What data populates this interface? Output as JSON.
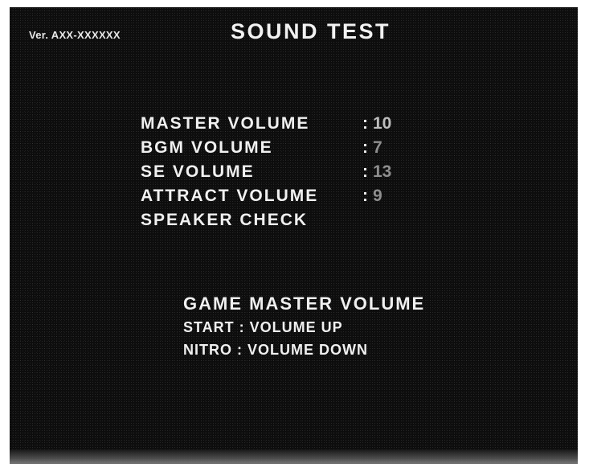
{
  "header": {
    "version": "Ver. AXX-XXXXXX",
    "title": "SOUND TEST"
  },
  "menu": {
    "items": [
      {
        "label": "MASTER VOLUME",
        "separator": ":",
        "value": "10"
      },
      {
        "label": "BGM VOLUME",
        "separator": ":",
        "value": "7"
      },
      {
        "label": "SE VOLUME",
        "separator": ":",
        "value": "13"
      },
      {
        "label": "ATTRACT VOLUME",
        "separator": ":",
        "value": "9"
      },
      {
        "label": "SPEAKER CHECK"
      }
    ]
  },
  "help": {
    "title": "GAME MASTER VOLUME",
    "line1": "START : VOLUME UP",
    "line2": "NITRO : VOLUME DOWN"
  },
  "colors": {
    "background": "#0d0d0d",
    "text": "#f0f0f0",
    "value": "#bdbdbd"
  }
}
